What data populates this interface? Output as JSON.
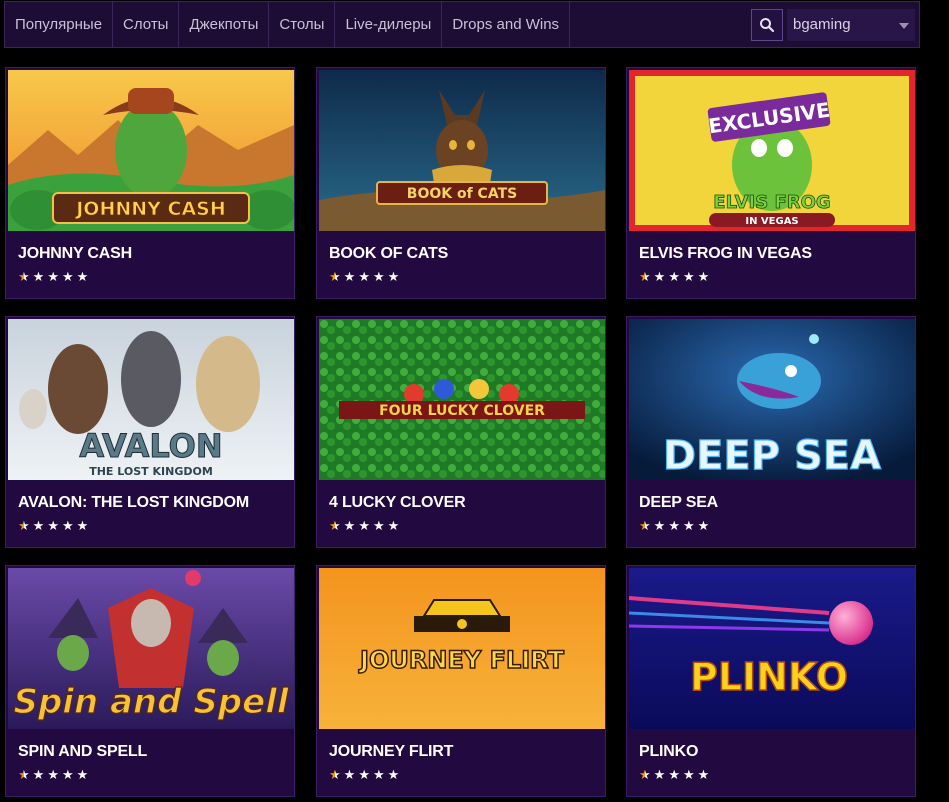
{
  "nav": {
    "tabs": [
      {
        "label": "Популярные"
      },
      {
        "label": "Слоты"
      },
      {
        "label": "Джекпоты"
      },
      {
        "label": "Столы"
      },
      {
        "label": "Live-дилеры"
      },
      {
        "label": "Drops and Wins"
      }
    ],
    "search_icon": "search-icon",
    "provider_select": {
      "value": "bgaming"
    }
  },
  "games": [
    {
      "title": "JOHNNY CASH",
      "logo": "JOHNNY CASH",
      "rating": 1,
      "max_rating": 5
    },
    {
      "title": "BOOK OF CATS",
      "logo": "BOOK of CATS",
      "rating": 1,
      "max_rating": 5
    },
    {
      "title": "ELVIS FROG IN VEGAS",
      "logo": "ELVIS FROG",
      "logo2": "IN VEGAS",
      "badge": "EXCLUSIVE",
      "rating": 1,
      "max_rating": 5
    },
    {
      "title": "AVALON: THE LOST KINGDOM",
      "logo": "AVALON",
      "logo2": "THE LOST KINGDOM",
      "rating": 1,
      "max_rating": 5
    },
    {
      "title": "4 LUCKY CLOVER",
      "logo": "FOUR LUCKY CLOVER",
      "rating": 1,
      "max_rating": 5
    },
    {
      "title": "DEEP SEA",
      "logo": "DEEP SEA",
      "rating": 1,
      "max_rating": 5
    },
    {
      "title": "SPIN AND SPELL",
      "logo": "Spin and Spell",
      "rating": 1,
      "max_rating": 5
    },
    {
      "title": "JOURNEY FLIRT",
      "logo": "JOURNEY FLIRT",
      "rating": 1,
      "max_rating": 5
    },
    {
      "title": "PLINKO",
      "logo": "PLINKO",
      "rating": 1,
      "max_rating": 5
    }
  ],
  "colors": {
    "background": "#000000",
    "card_bg": "#22093f",
    "nav_bg": "#1d0c34",
    "star_active": "#f29a1f",
    "star_inactive": "#ffffff"
  }
}
